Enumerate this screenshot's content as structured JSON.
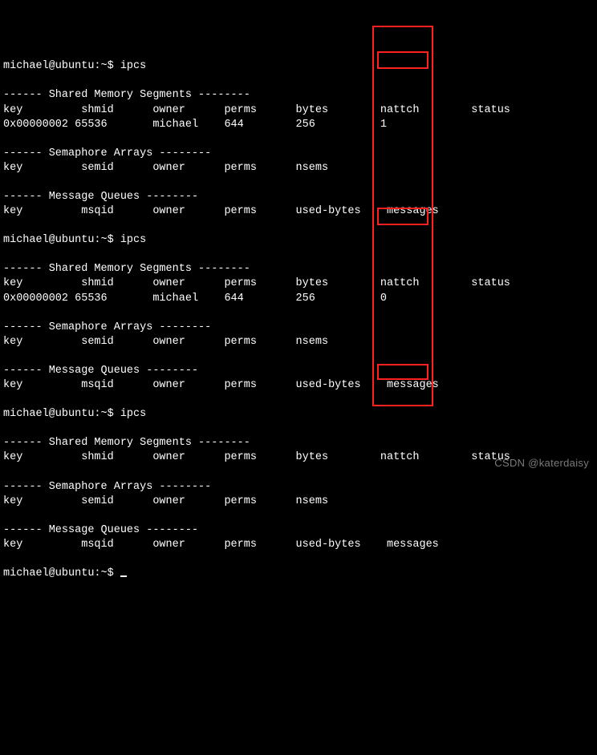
{
  "prompt": "michael@ubuntu:~$",
  "command": "ipcs",
  "section_shm": {
    "title": "------ Shared Memory Segments --------",
    "hdr": {
      "key": "key",
      "shmid": "shmid",
      "owner": "owner",
      "perms": "perms",
      "bytes": "bytes",
      "nattch": "nattch",
      "status": "status"
    }
  },
  "section_sem": {
    "title": "------ Semaphore Arrays --------",
    "hdr": {
      "key": "key",
      "semid": "semid",
      "owner": "owner",
      "perms": "perms",
      "nsems": "nsems"
    }
  },
  "section_msg": {
    "title": "------ Message Queues --------",
    "hdr": {
      "key": "key",
      "msqid": "msqid",
      "owner": "owner",
      "perms": "perms",
      "usedbytes": "used-bytes",
      "messages": "messages"
    }
  },
  "run1_row": {
    "key": "0x00000002",
    "shmid": "65536",
    "owner": "michael",
    "perms": "644",
    "bytes": "256",
    "nattch": "1"
  },
  "run2_row": {
    "key": "0x00000002",
    "shmid": "65536",
    "owner": "michael",
    "perms": "644",
    "bytes": "256",
    "nattch": "0"
  },
  "watermark": "CSDN @katerdaisy"
}
